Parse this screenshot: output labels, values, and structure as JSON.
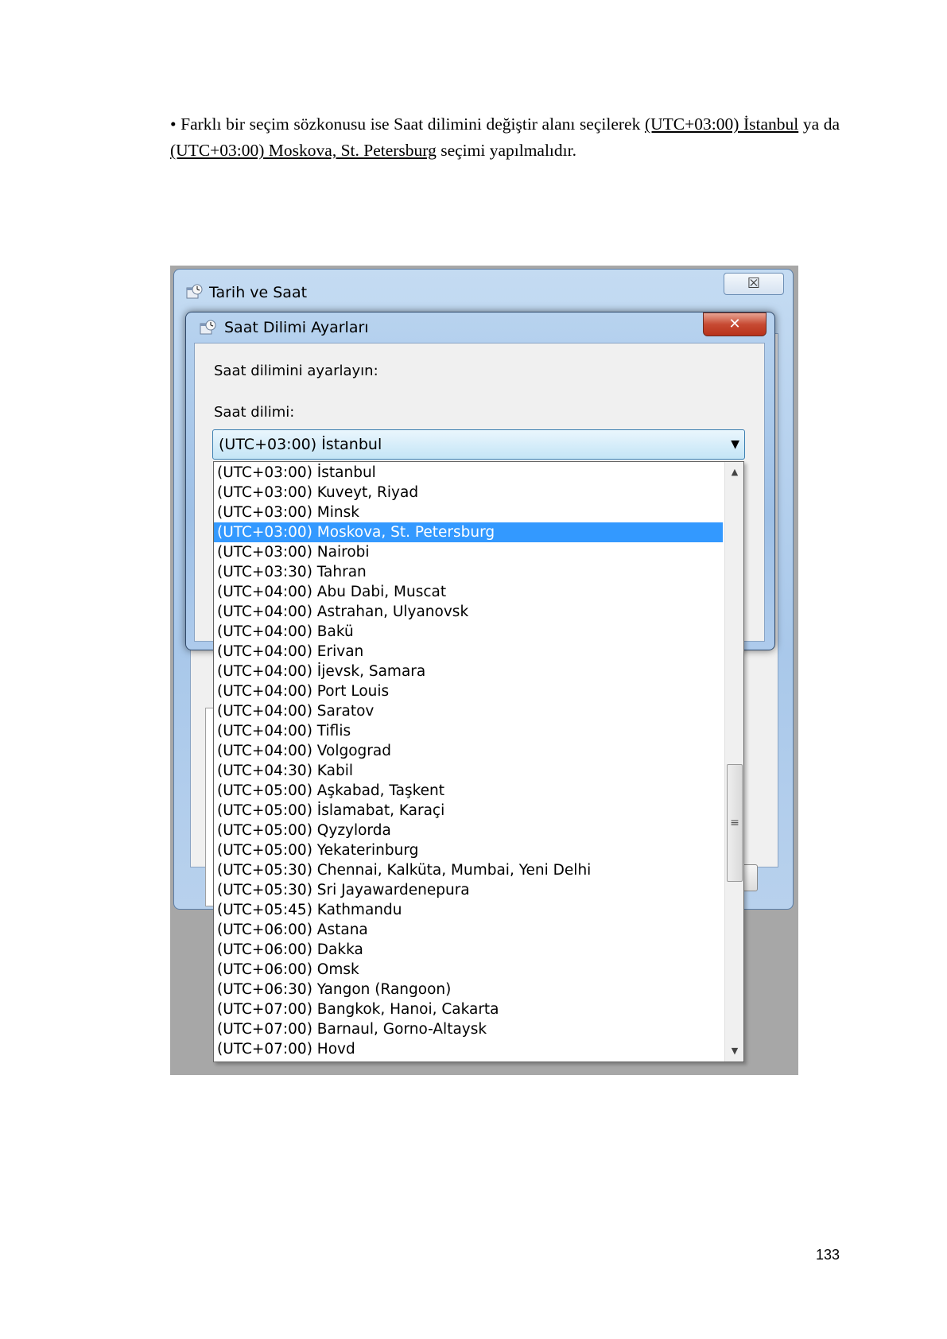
{
  "paragraph": {
    "bullet": "•",
    "part1": "Farklı bir seçim sözkonusu ise Saat dilimini değiştir alanı seçilerek",
    "option1": "(UTC+03:00) İstanbul",
    "part2": "ya da",
    "option2": "(UTC+03:00) Moskova, St. Petersburg",
    "part3": "seçimi yapılmalıdır."
  },
  "screenshot": {
    "outer_window": {
      "title": "Tarih ve Saat",
      "close_glyph": "☒"
    },
    "dialog": {
      "title": "Saat Dilimi Ayarları",
      "close_glyph": "✕",
      "instruction": "Saat dilimini ayarlayın:",
      "timezone_label": "Saat dilimi:",
      "selected_value": "(UTC+03:00) İstanbul",
      "dropdown_arrow": "▼"
    },
    "timezone_list": {
      "selected_index": 3,
      "items": [
        "(UTC+03:00) İstanbul",
        "(UTC+03:00) Kuveyt, Riyad",
        "(UTC+03:00) Minsk",
        "(UTC+03:00) Moskova, St. Petersburg",
        "(UTC+03:00) Nairobi",
        "(UTC+03:30) Tahran",
        "(UTC+04:00) Abu Dabi, Muscat",
        "(UTC+04:00) Astrahan, Ulyanovsk",
        "(UTC+04:00) Bakü",
        "(UTC+04:00) Erivan",
        "(UTC+04:00) İjevsk, Samara",
        "(UTC+04:00) Port Louis",
        "(UTC+04:00) Saratov",
        "(UTC+04:00) Tiflis",
        "(UTC+04:00) Volgograd",
        "(UTC+04:30) Kabil",
        "(UTC+05:00) Aşkabad, Taşkent",
        "(UTC+05:00) İslamabat, Karaçi",
        "(UTC+05:00) Qyzylorda",
        "(UTC+05:00) Yekaterinburg",
        "(UTC+05:30) Chennai, Kalküta, Mumbai, Yeni Delhi",
        "(UTC+05:30) Sri Jayawardenepura",
        "(UTC+05:45) Kathmandu",
        "(UTC+06:00) Astana",
        "(UTC+06:00) Dakka",
        "(UTC+06:00) Omsk",
        "(UTC+06:30) Yangon (Rangoon)",
        "(UTC+07:00) Bangkok, Hanoi, Cakarta",
        "(UTC+07:00) Barnaul, Gorno-Altaysk",
        "(UTC+07:00) Hovd"
      ],
      "scrollbar": {
        "up": "▲",
        "down": "▼",
        "grip": "≡"
      }
    }
  },
  "page_number": "133"
}
